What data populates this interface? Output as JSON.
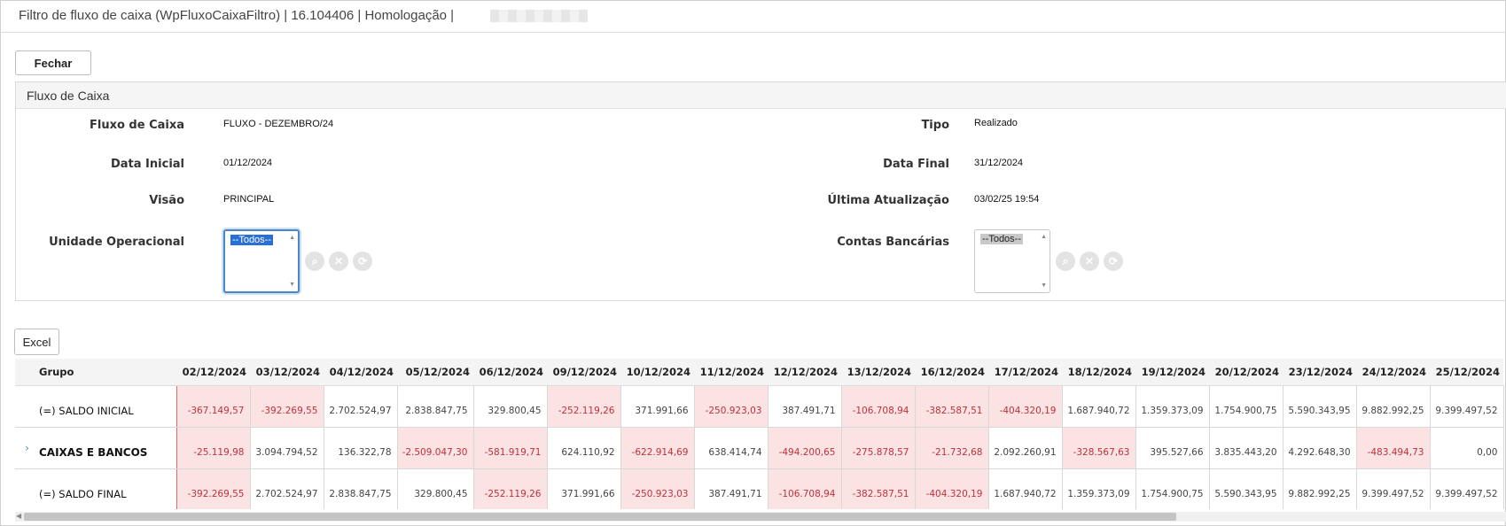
{
  "window": {
    "title": "Filtro de fluxo de caixa (WpFluxoCaixaFiltro) | 16.104406 | Homologação |"
  },
  "toolbar": {
    "close_label": "Fechar",
    "excel_label": "Excel"
  },
  "panel": {
    "title": "Fluxo de Caixa",
    "fields": {
      "fluxo_label": "Fluxo de Caixa",
      "fluxo_value": "FLUXO - DEZEMBRO/24",
      "tipo_label": "Tipo",
      "tipo_value": "Realizado",
      "data_inicial_label": "Data Inicial",
      "data_inicial_value": "01/12/2024",
      "data_final_label": "Data Final",
      "data_final_value": "31/12/2024",
      "visao_label": "Visão",
      "visao_value": "PRINCIPAL",
      "ultima_label": "Última Atualização",
      "ultima_value": "03/02/25 19:54",
      "unidade_label": "Unidade Operacional",
      "unidade_selected": "--Todos--",
      "contas_label": "Contas Bancárias",
      "contas_selected": "--Todos--"
    }
  },
  "grid": {
    "group_header": "Grupo",
    "dates": [
      "02/12/2024",
      "03/12/2024",
      "04/12/2024",
      "05/12/2024",
      "06/12/2024",
      "09/12/2024",
      "10/12/2024",
      "11/12/2024",
      "12/12/2024",
      "13/12/2024",
      "16/12/2024",
      "17/12/2024",
      "18/12/2024",
      "19/12/2024",
      "20/12/2024",
      "23/12/2024",
      "24/12/2024",
      "25/12/2024"
    ],
    "rows": [
      {
        "label": "(=) SALDO INICIAL",
        "expandable": false,
        "bold": false,
        "values": [
          "-367.149,57",
          "-392.269,55",
          "2.702.524,97",
          "2.838.847,75",
          "329.800,45",
          "-252.119,26",
          "371.991,66",
          "-250.923,03",
          "387.491,71",
          "-106.708,94",
          "-382.587,51",
          "-404.320,19",
          "1.687.940,72",
          "1.359.373,09",
          "1.754.900,75",
          "5.590.343,95",
          "9.882.992,25",
          "9.399.497,52"
        ]
      },
      {
        "label": "CAIXAS E BANCOS",
        "expandable": true,
        "bold": true,
        "values": [
          "-25.119,98",
          "3.094.794,52",
          "136.322,78",
          "-2.509.047,30",
          "-581.919,71",
          "624.110,92",
          "-622.914,69",
          "638.414,74",
          "-494.200,65",
          "-275.878,57",
          "-21.732,68",
          "2.092.260,91",
          "-328.567,63",
          "395.527,66",
          "3.835.443,20",
          "4.292.648,30",
          "-483.494,73",
          "0,00"
        ]
      },
      {
        "label": "(=) SALDO FINAL",
        "expandable": false,
        "bold": false,
        "values": [
          "-392.269,55",
          "2.702.524,97",
          "2.838.847,75",
          "329.800,45",
          "-252.119,26",
          "371.991,66",
          "-250.923,03",
          "387.491,71",
          "-106.708,94",
          "-382.587,51",
          "-404.320,19",
          "1.687.940,72",
          "1.359.373,09",
          "1.754.900,75",
          "5.590.343,95",
          "9.882.992,25",
          "9.399.497,52",
          "9.399.497,52"
        ]
      }
    ]
  },
  "icons": {
    "search": "search-icon",
    "clear": "clear-icon",
    "refresh": "refresh-icon",
    "expand": "chevron-right-icon"
  },
  "colors": {
    "negative_text": "#c0303a",
    "negative_bg": "#fbe3e3",
    "focus": "#4a86c7"
  }
}
